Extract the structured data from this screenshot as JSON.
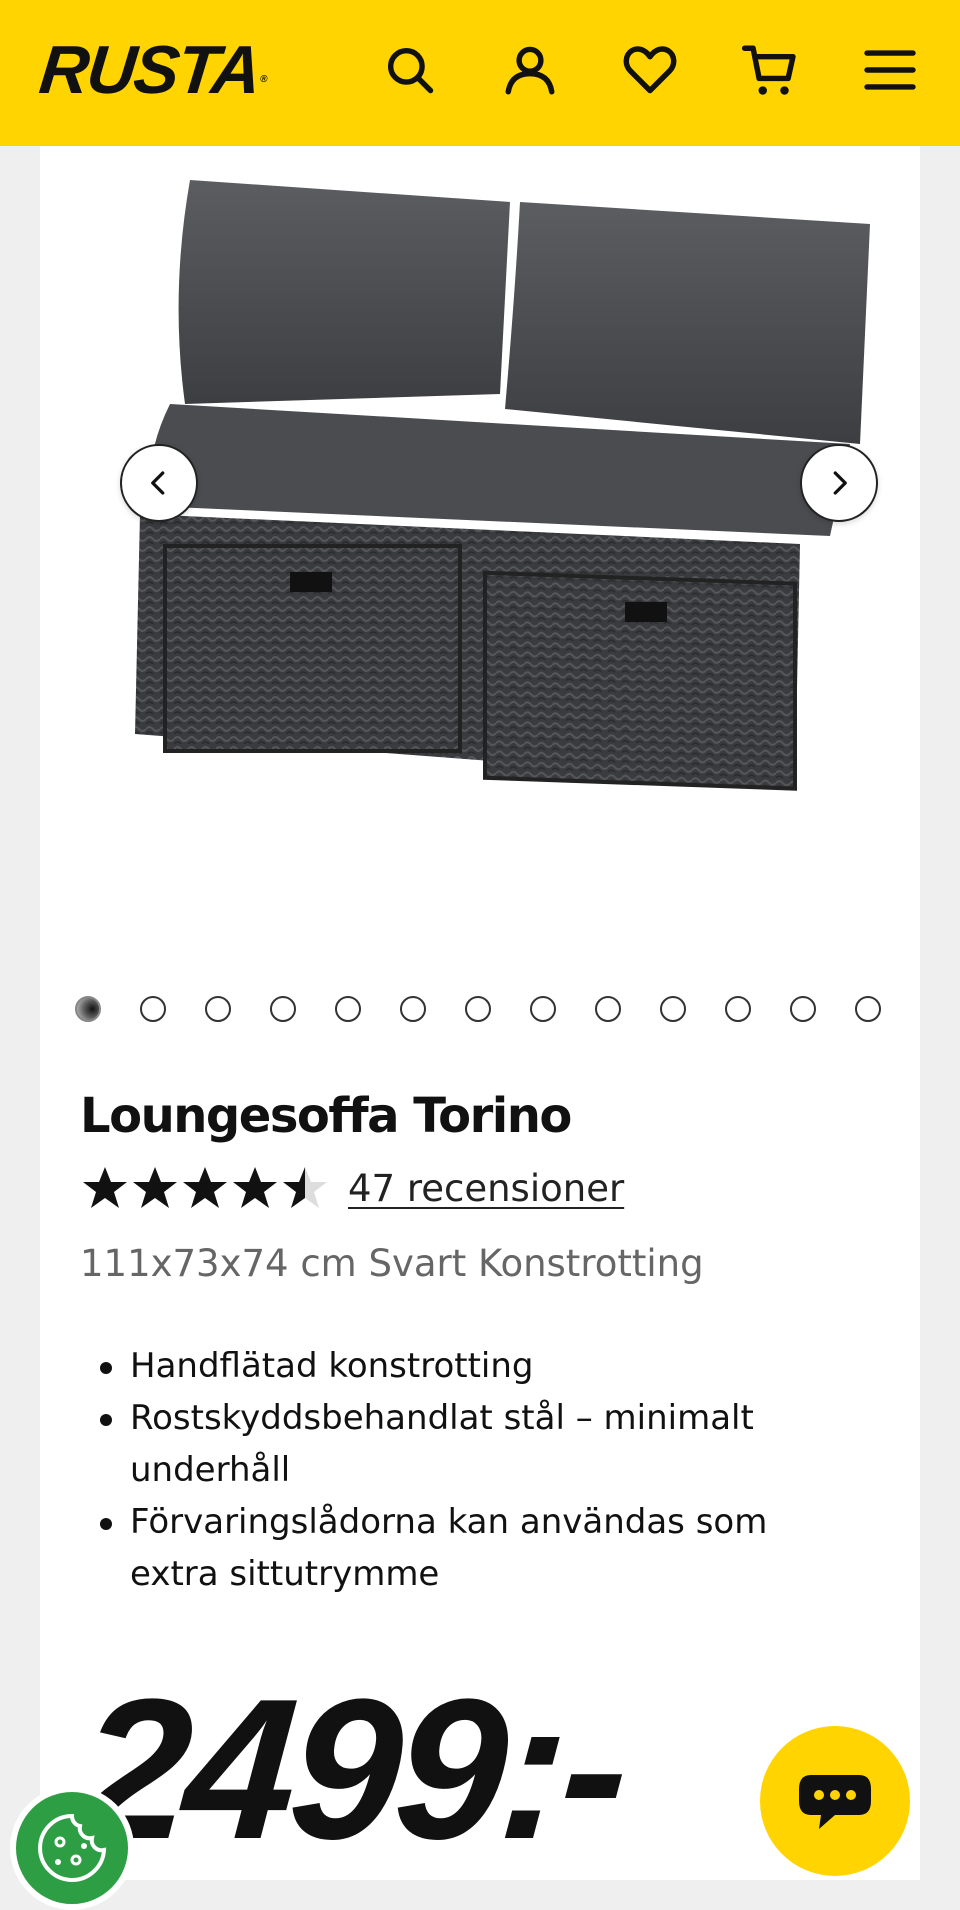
{
  "header": {
    "logo": "RUSTA",
    "logo_mark": "®",
    "icons": [
      "search-icon",
      "account-icon",
      "heart-icon",
      "cart-icon",
      "menu-icon"
    ],
    "background": "#ffd400"
  },
  "gallery": {
    "image_alt": "Loungesoffa Torino",
    "dot_count": 13,
    "active_dot": 1
  },
  "product": {
    "title": "Loungesoffa Torino",
    "rating": 4.5,
    "rating_max": 5,
    "reviews_label": "47 recensioner",
    "subtitle": "111x73x74 cm Svart Konstrotting",
    "features": [
      "Handflätad konstrotting",
      "Rostskyddsbehandlat stål – minimalt underhåll",
      "Förvaringslådorna kan användas som extra sittutrymme"
    ],
    "price": "2499:-"
  },
  "colors": {
    "brand_yellow": "#ffd400",
    "cookie_green": "#2e9e45"
  }
}
